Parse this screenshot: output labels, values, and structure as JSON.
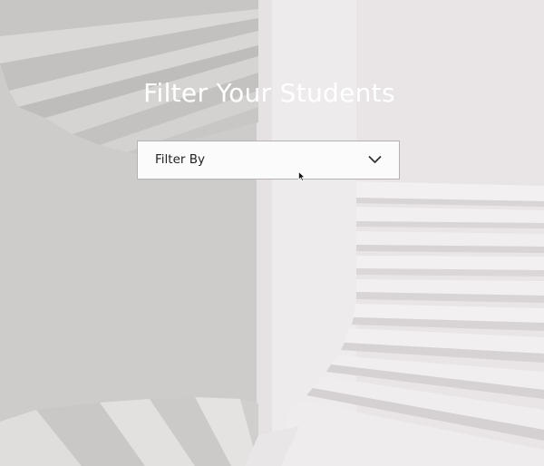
{
  "page": {
    "title": "Filter Your Students"
  },
  "filter": {
    "label": "Filter By",
    "icon": "chevron-down-icon"
  },
  "pointer": {
    "icon": "mouse-pointer-icon"
  },
  "colors": {
    "title_text": "#ffffff",
    "dropdown_bg": "#fbfbfb",
    "dropdown_border": "#b5b2b4",
    "label_text": "#222222"
  }
}
